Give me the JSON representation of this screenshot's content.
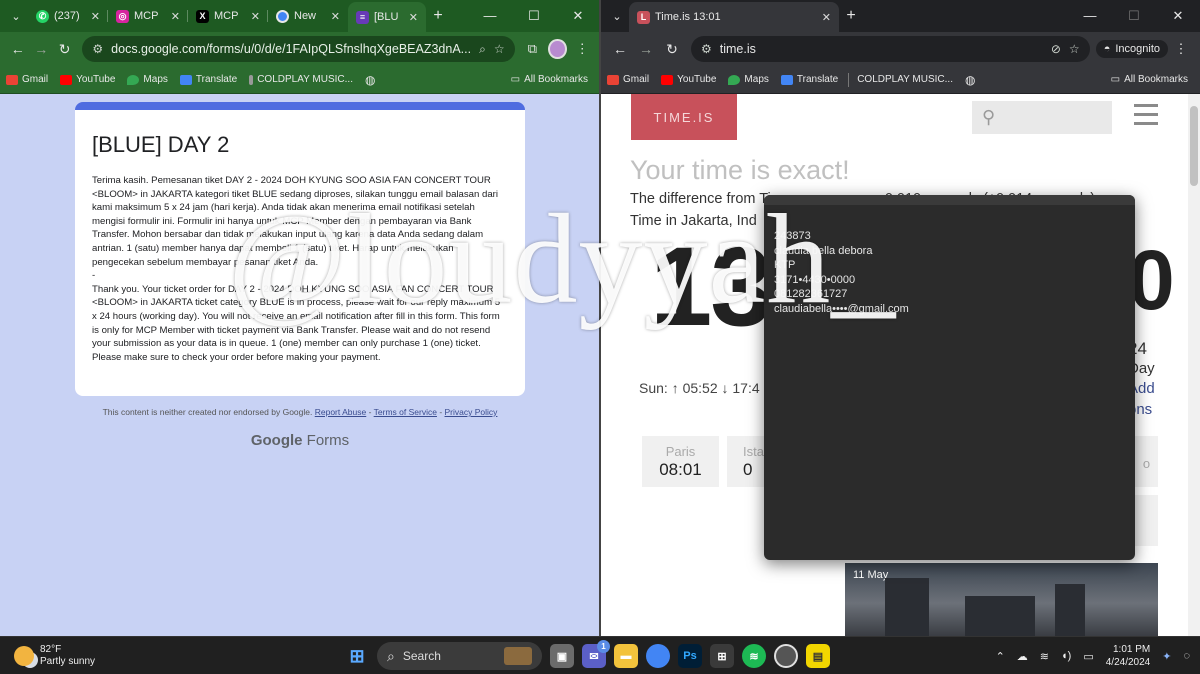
{
  "left": {
    "tabs": [
      {
        "label": "(237)",
        "icon": "whatsapp-icon",
        "color": "#25d366"
      },
      {
        "label": "MCP",
        "icon": "instagram-icon",
        "color": "#d6249f"
      },
      {
        "label": "MCP",
        "icon": "x-icon",
        "color": "#000000"
      },
      {
        "label": "New",
        "icon": "chrome-icon",
        "color": "#4285f4"
      },
      {
        "label": "[BLU",
        "icon": "google-forms-icon",
        "color": "#673ab7"
      }
    ],
    "url": "docs.google.com/forms/u/0/d/e/1FAIpQLSfnslhqXgeBEAZ3dnA...",
    "bookmarks": [
      "Gmail",
      "YouTube",
      "Maps",
      "Translate",
      "COLDPLAY MUSIC..."
    ],
    "all_bookmarks": "All Bookmarks",
    "form": {
      "title": "[BLUE] DAY 2",
      "body": "Terima kasih. Pemesanan tiket DAY 2 - 2024 DOH KYUNG SOO ASIA FAN CONCERT TOUR <BLOOM> in JAKARTA kategori tiket BLUE sedang diproses, silakan tunggu email balasan dari kami maksimum 5 x 24 jam (hari kerja). Anda tidak akan menerima email notifikasi setelah mengisi formulir ini. Formulir ini hanya untuk MCP Member dengan pembayaran via Bank Transfer. Mohon bersabar dan tidak melakukan input ulang karena data Anda sedang dalam antrian. 1 (satu) member hanya dapat membeli 1 (satu) tiket. Harap untuk melakukan pengecekan sebelum membayar pesanan tiket Anda.\n-\nThank you. Your ticket order for DAY 2 - 2024 DOH KYUNG SOO ASIA FAN CONCERT TOUR <BLOOM> in JAKARTA ticket category BLUE is in process, please wait for our reply maximum 5 x 24 hours (working day). You will not receive an email notification after fill in this form. This form is only for MCP Member with ticket payment via Bank Transfer. Please wait and do not resend your submission as your data is in queue. 1 (one) member can only purchase 1 (one) ticket. Please make sure to check your order before making your payment.",
      "footer_text": "This content is neither created nor endorsed by Google.",
      "footer_links": [
        "Report Abuse",
        "Terms of Service",
        "Privacy Policy"
      ],
      "brand_google": "Google",
      "brand_forms": "Forms"
    }
  },
  "right": {
    "tab_label": "Time.is 13:01",
    "url": "time.is",
    "incognito_label": "Incognito",
    "bookmarks": [
      "Gmail",
      "YouTube",
      "Maps",
      "Translate",
      "COLDPLAY MUSIC..."
    ],
    "all_bookmarks": "All Bookmarks",
    "timeis": {
      "logo": "TIME.IS",
      "headline": "Your time is exact!",
      "diff_line1": "The difference from Ti",
      "diff_line1_tail": "0.010 seconds (±0.014 seconds).",
      "diff_line2": "Time in Jakarta, Ind",
      "big_time_left": "13",
      "big_time_right": "0",
      "sun_line": "Sun: ↑ 05:52 ↓ 17:4",
      "side_year": "24",
      "side_day": "Day",
      "side_add": "Add",
      "side_ons": "ons",
      "cities": [
        {
          "name": "Paris",
          "time": "08:01"
        },
        {
          "name": "Ista",
          "time": "0"
        }
      ],
      "city_right_partial": "o",
      "promo_date": "11 May"
    },
    "notepad_lines": [
      "243873",
      "claudia bella debora",
      "KTP",
      "3171•4430•0000",
      "081282361727",
      "claudiabella••••@gmail.com"
    ]
  },
  "watermark": "@loudyyah_",
  "taskbar": {
    "temp": "82°F",
    "condition": "Partly sunny",
    "search_label": "Search",
    "time": "1:01 PM",
    "date": "4/24/2024",
    "chat_badge": "1"
  }
}
